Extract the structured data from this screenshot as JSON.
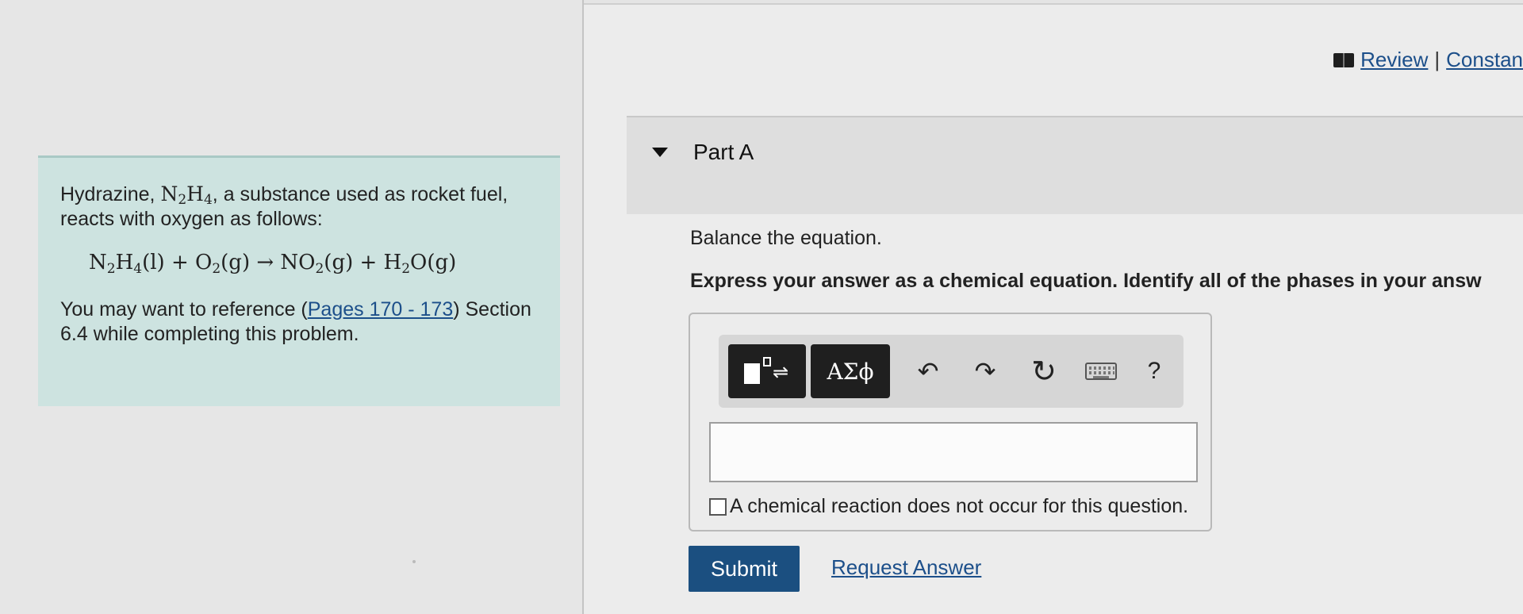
{
  "header": {
    "review_label": "Review",
    "separator": "|",
    "constants_label": "Constan"
  },
  "problem": {
    "intro_prefix": "Hydrazine, ",
    "formula_n": "N",
    "formula_n_sub": "2",
    "formula_h": "H",
    "formula_h_sub": "4",
    "intro_suffix": ", a substance used as rocket fuel, reacts with oxygen as follows:",
    "equation": {
      "r1": "N",
      "r1s1": "2",
      "r1h": "H",
      "r1s2": "4",
      "r1phase": "(l) + O",
      "r2s": "2",
      "r2phase": "(g) → NO",
      "p1s": "2",
      "p1phase": "(g) + H",
      "p2s": "2",
      "p2phase": "O(g)"
    },
    "reference_prefix": "You may want to reference (",
    "reference_link": "Pages 170 - 173",
    "reference_suffix": ") Section 6.4 while completing this problem."
  },
  "part": {
    "title": "Part A",
    "question": "Balance the equation.",
    "instructions": "Express your answer as a chemical equation. Identify all of the phases in your answ"
  },
  "toolbar": {
    "greek_label": "ΑΣϕ",
    "undo_glyph": "↶",
    "redo_glyph": "↷",
    "reset_glyph": "↻",
    "help_label": "?"
  },
  "answer": {
    "value": "",
    "no_reaction_label": "A chemical reaction does not occur for this question."
  },
  "actions": {
    "submit_label": "Submit",
    "request_answer_label": "Request Answer"
  }
}
